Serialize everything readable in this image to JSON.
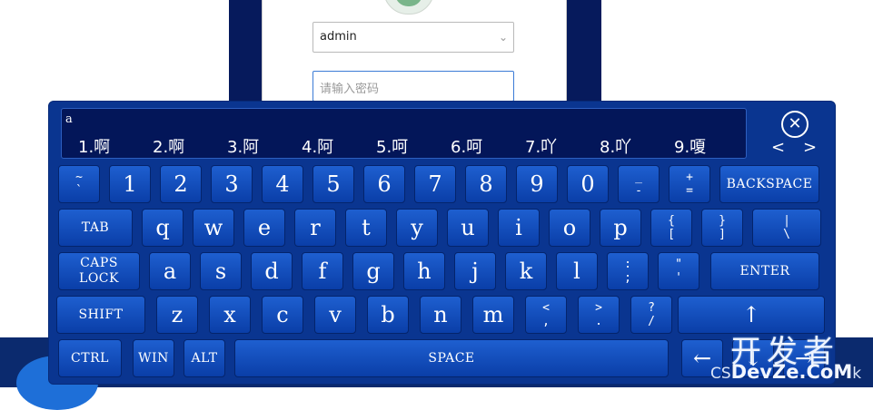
{
  "login": {
    "username_value": "admin",
    "password_placeholder": "请输入密码",
    "dropdown_glyph": "⌄"
  },
  "keyboard": {
    "candidate_input": "a",
    "candidates": [
      "1.啊",
      "2.啊",
      "3.阿",
      "4.阿",
      "5.呵",
      "6.呵",
      "7.吖",
      "8.吖",
      "9.嗄"
    ],
    "close_glyph": "⊗",
    "prev_glyph": "<",
    "next_glyph": ">",
    "row1": [
      {
        "top": "~",
        "bottom": "`"
      },
      {
        "main": "1"
      },
      {
        "main": "2"
      },
      {
        "main": "3"
      },
      {
        "main": "4"
      },
      {
        "main": "5"
      },
      {
        "main": "6"
      },
      {
        "main": "7"
      },
      {
        "main": "8"
      },
      {
        "main": "9"
      },
      {
        "main": "0"
      },
      {
        "top": "_",
        "bottom": "-"
      },
      {
        "top": "+",
        "bottom": "="
      },
      {
        "word": "BACKSPACE"
      }
    ],
    "row2": [
      {
        "word": "TAB"
      },
      {
        "main": "q"
      },
      {
        "main": "w"
      },
      {
        "main": "e"
      },
      {
        "main": "r"
      },
      {
        "main": "t"
      },
      {
        "main": "y"
      },
      {
        "main": "u"
      },
      {
        "main": "i"
      },
      {
        "main": "o"
      },
      {
        "main": "p"
      },
      {
        "top": "{",
        "bottom": "["
      },
      {
        "top": "}",
        "bottom": "]"
      },
      {
        "top": "|",
        "bottom": "\\"
      }
    ],
    "row3": [
      {
        "word": "CAPS",
        "word2": "LOCK"
      },
      {
        "main": "a"
      },
      {
        "main": "s"
      },
      {
        "main": "d"
      },
      {
        "main": "f"
      },
      {
        "main": "g"
      },
      {
        "main": "h"
      },
      {
        "main": "j"
      },
      {
        "main": "k"
      },
      {
        "main": "l"
      },
      {
        "top": ":",
        "bottom": ";"
      },
      {
        "top": "\"",
        "bottom": "'"
      },
      {
        "word": "ENTER"
      }
    ],
    "row4": [
      {
        "word": "SHIFT"
      },
      {
        "main": "z"
      },
      {
        "main": "x"
      },
      {
        "main": "c"
      },
      {
        "main": "v"
      },
      {
        "main": "b"
      },
      {
        "main": "n"
      },
      {
        "main": "m"
      },
      {
        "top": "<",
        "bottom": ","
      },
      {
        "top": ">",
        "bottom": "."
      },
      {
        "top": "?",
        "bottom": "/"
      },
      {
        "main": "↑"
      }
    ],
    "row5": [
      {
        "word": "CTRL"
      },
      {
        "word": "WIN"
      },
      {
        "word": "ALT"
      },
      {
        "word": "SPACE"
      },
      {
        "main": "←"
      },
      {
        "main": "↓"
      },
      {
        "main": "→"
      }
    ]
  },
  "watermark": {
    "cn": "开发者",
    "prefix": "CS",
    "brand": "DevZe.CoM",
    "suffix": "k"
  },
  "colors": {
    "keyboard_bg": "#0a3590",
    "key_top": "#1e5fd0",
    "key_bottom": "#0a3ea8",
    "candidate_bg": "#031659",
    "login_bg": "#061a5c"
  }
}
